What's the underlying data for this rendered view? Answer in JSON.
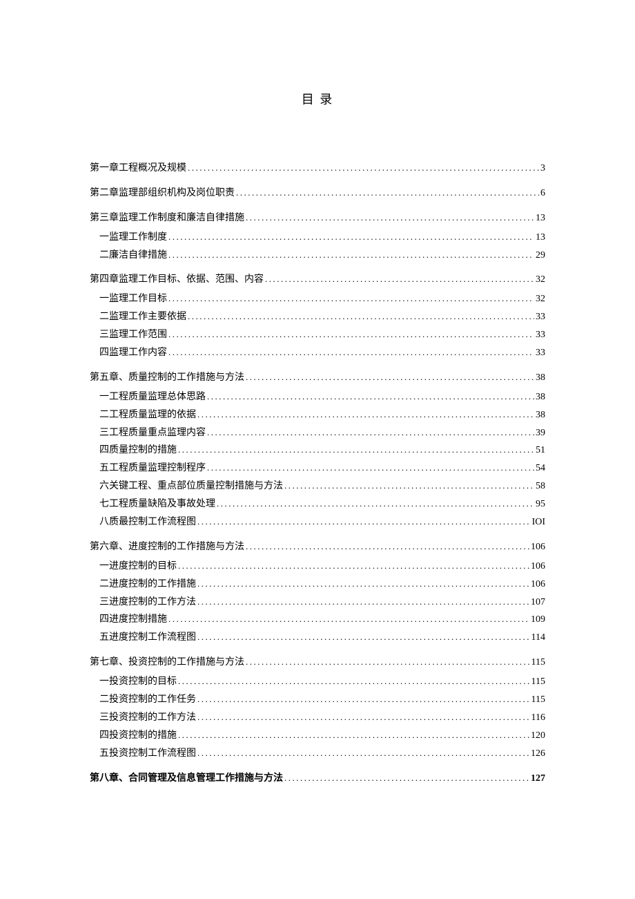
{
  "title": "目 录",
  "toc": [
    {
      "level": "chapter",
      "label": "第一章工程概况及规模",
      "page": "3"
    },
    {
      "level": "chapter",
      "label": "第二章监理部组织机构及岗位职责",
      "page": "6"
    },
    {
      "level": "chapter",
      "label": "第三章监理工作制度和廉洁自律措施",
      "page": "13"
    },
    {
      "level": "sub",
      "label": "一监理工作制度",
      "page": "13"
    },
    {
      "level": "sub",
      "label": "二廉洁自律措施",
      "page": "29"
    },
    {
      "level": "chapter",
      "label": "第四章监理工作目标、依据、范围、内容",
      "page": "32"
    },
    {
      "level": "sub",
      "label": "一监理工作目标",
      "page": "32"
    },
    {
      "level": "sub",
      "label": "二监理工作主要依据",
      "page": "33"
    },
    {
      "level": "sub",
      "label": "三监理工作范围",
      "page": "33"
    },
    {
      "level": "sub",
      "label": "四监理工作内容",
      "page": "33"
    },
    {
      "level": "chapter",
      "label": "第五章、质量控制的工作措施与方法",
      "page": "38"
    },
    {
      "level": "sub",
      "label": "一工程质量监理总体思路",
      "page": "38"
    },
    {
      "level": "sub",
      "label": "二工程质量监理的依据",
      "page": "38"
    },
    {
      "level": "sub",
      "label": "三工程质量重点监理内容",
      "page": "39"
    },
    {
      "level": "sub",
      "label": "四质量控制的措施",
      "page": "51"
    },
    {
      "level": "sub",
      "label": "五工程质量监理控制程序",
      "page": "54"
    },
    {
      "level": "sub",
      "label": "六关键工程、重点部位质量控制措施与方法",
      "page": "58"
    },
    {
      "level": "sub",
      "label": "七工程质量缺陷及事故处理",
      "page": "95"
    },
    {
      "level": "sub",
      "label": "八质最控制工作流程图",
      "page": "IOI"
    },
    {
      "level": "chapter",
      "label": "第六章、进度控制的工作措施与方法",
      "page": "106"
    },
    {
      "level": "sub",
      "label": "一进度控制的目标",
      "page": "106"
    },
    {
      "level": "sub",
      "label": "二进度控制的工作措施",
      "page": "106"
    },
    {
      "level": "sub",
      "label": "三进度控制的工作方法",
      "page": "107"
    },
    {
      "level": "sub",
      "label": "四进度控制措施",
      "page": "109"
    },
    {
      "level": "sub",
      "label": "五进度控制工作流程图",
      "page": "114"
    },
    {
      "level": "chapter",
      "label": "第七章、投资控制的工作措施与方法",
      "page": "115"
    },
    {
      "level": "sub",
      "label": "一投资控制的目标",
      "page": "115"
    },
    {
      "level": "sub",
      "label": "二投资控制的工作任务",
      "page": "115"
    },
    {
      "level": "sub",
      "label": "三投资控制的工作方法",
      "page": "116"
    },
    {
      "level": "sub",
      "label": "四投资控制的措施",
      "page": "120"
    },
    {
      "level": "sub",
      "label": "五投资控制工作流程图",
      "page": "126"
    },
    {
      "level": "chapter",
      "label": "第八章、合同管理及信息管理工作措施与方法",
      "page": "127",
      "bold": true
    }
  ]
}
